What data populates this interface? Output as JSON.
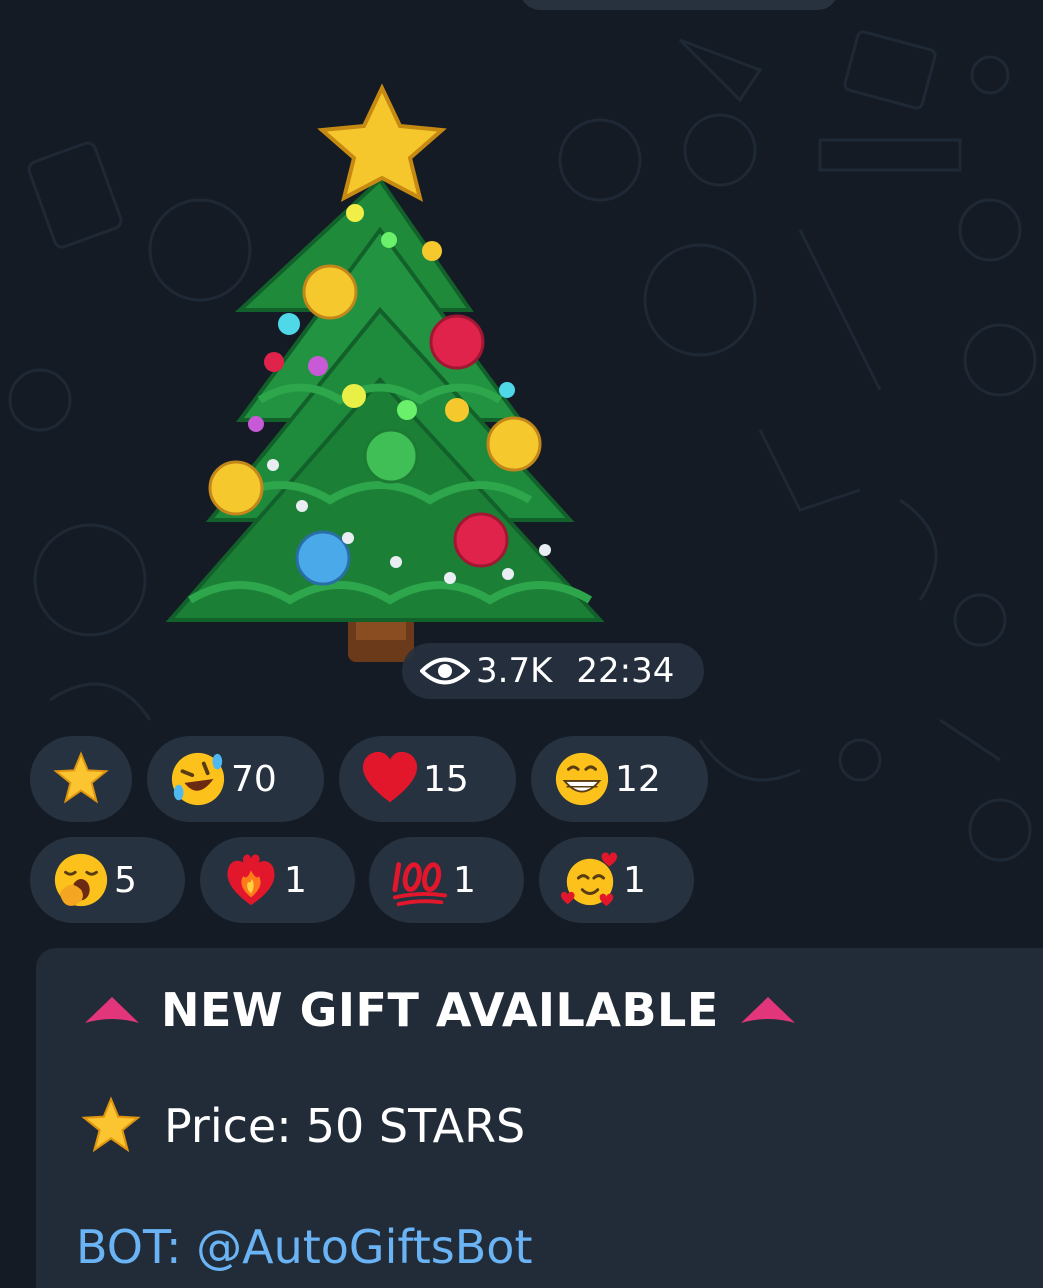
{
  "post": {
    "views": "3.7K",
    "time": "22:34"
  },
  "reactions": [
    {
      "emoji": "star-icon",
      "count": ""
    },
    {
      "emoji": "rofl-emoji-icon",
      "count": "70"
    },
    {
      "emoji": "red-heart-icon",
      "count": "15"
    },
    {
      "emoji": "grinning-face-icon",
      "count": "12"
    },
    {
      "emoji": "yawning-face-icon",
      "count": "5"
    },
    {
      "emoji": "heart-on-fire-icon",
      "count": "1"
    },
    {
      "emoji": "hundred-points-icon",
      "count": "1"
    },
    {
      "emoji": "smiling-face-with-hearts-icon",
      "count": "1"
    }
  ],
  "message": {
    "heading": "NEW GIFT AVAILABLE",
    "price_label": "Price:",
    "price_value": "50 STARS",
    "bot_text": "BOT: @AutoGiftsBot"
  },
  "colors": {
    "background": "#141b25",
    "bubble": "#222c39",
    "reaction_pill": "#273240",
    "link": "#6ab4f5",
    "accent_triangle": "#e2357a"
  }
}
